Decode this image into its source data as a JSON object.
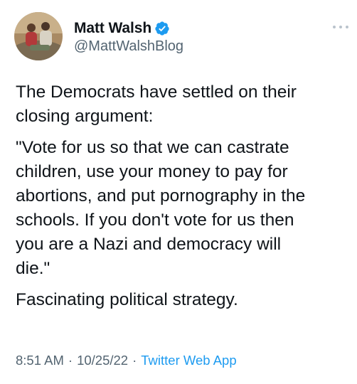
{
  "author": {
    "display_name": "Matt Walsh",
    "handle": "@MattWalshBlog",
    "verified": true,
    "verified_color": "#1d9bf0"
  },
  "tweet": {
    "paragraphs": [
      "The Democrats have settled on their\nclosing argument:",
      "\"Vote for us so that we can castrate\nchildren, use your money to pay for\nabortions, and put pornography in the\nschools. If you don't vote for us then\nyou are a Nazi and democracy will\ndie.\"",
      "Fascinating political strategy."
    ]
  },
  "meta": {
    "time": "8:51 AM",
    "separator": "·",
    "date": "10/25/22",
    "source": "Twitter Web App"
  },
  "icons": {
    "more": "more-horizontal-icon",
    "verified": "verified-badge-icon"
  }
}
